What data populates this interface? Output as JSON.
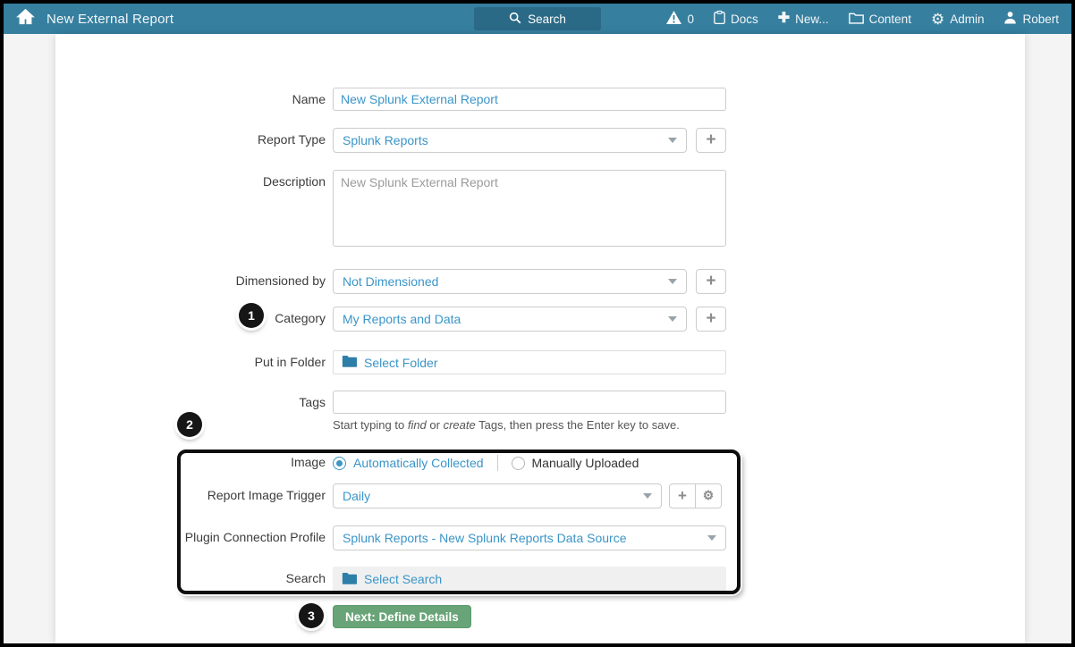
{
  "header": {
    "title": "New External Report",
    "search_label": "Search",
    "alerts_count": "0",
    "nav": {
      "docs": "Docs",
      "new": "New...",
      "content": "Content",
      "admin": "Admin",
      "user": "Robert"
    }
  },
  "colors": {
    "header_teal": "#367f9f",
    "search_button_teal": "#2b6a87",
    "link_blue": "#3a95c8",
    "folder_icon_blue": "#2e7fa8",
    "next_button_green": "#68a477",
    "annotation_black": "#0e0e0e"
  },
  "form": {
    "name": {
      "label": "Name",
      "value": "New Splunk External Report"
    },
    "report_type": {
      "label": "Report Type",
      "value": "Splunk Reports"
    },
    "description": {
      "label": "Description",
      "placeholder": "New Splunk External Report"
    },
    "dimensioned_by": {
      "label": "Dimensioned by",
      "value": "Not Dimensioned"
    },
    "category": {
      "label": "Category",
      "value": "My Reports and Data",
      "badge": "1"
    },
    "put_in_folder": {
      "label": "Put in Folder",
      "value": "Select Folder"
    },
    "tags": {
      "label": "Tags",
      "value": "",
      "hint_p1": "Start typing to ",
      "hint_find": "find",
      "hint_p2": " or ",
      "hint_create": "create",
      "hint_p3": " Tags, then press the Enter key to save."
    }
  },
  "image_section": {
    "badge": "2",
    "image": {
      "label": "Image",
      "options": [
        {
          "label": "Automatically Collected",
          "selected": true
        },
        {
          "label": "Manually Uploaded",
          "selected": false
        }
      ]
    },
    "report_image_trigger": {
      "label": "Report Image Trigger",
      "value": "Daily"
    },
    "plugin_connection_profile": {
      "label": "Plugin Connection Profile",
      "value": "Splunk Reports - New Splunk Reports Data Source"
    },
    "search": {
      "label": "Search",
      "value": "Select Search"
    }
  },
  "footer": {
    "badge": "3",
    "next_button_label": "Next: Define Details"
  }
}
